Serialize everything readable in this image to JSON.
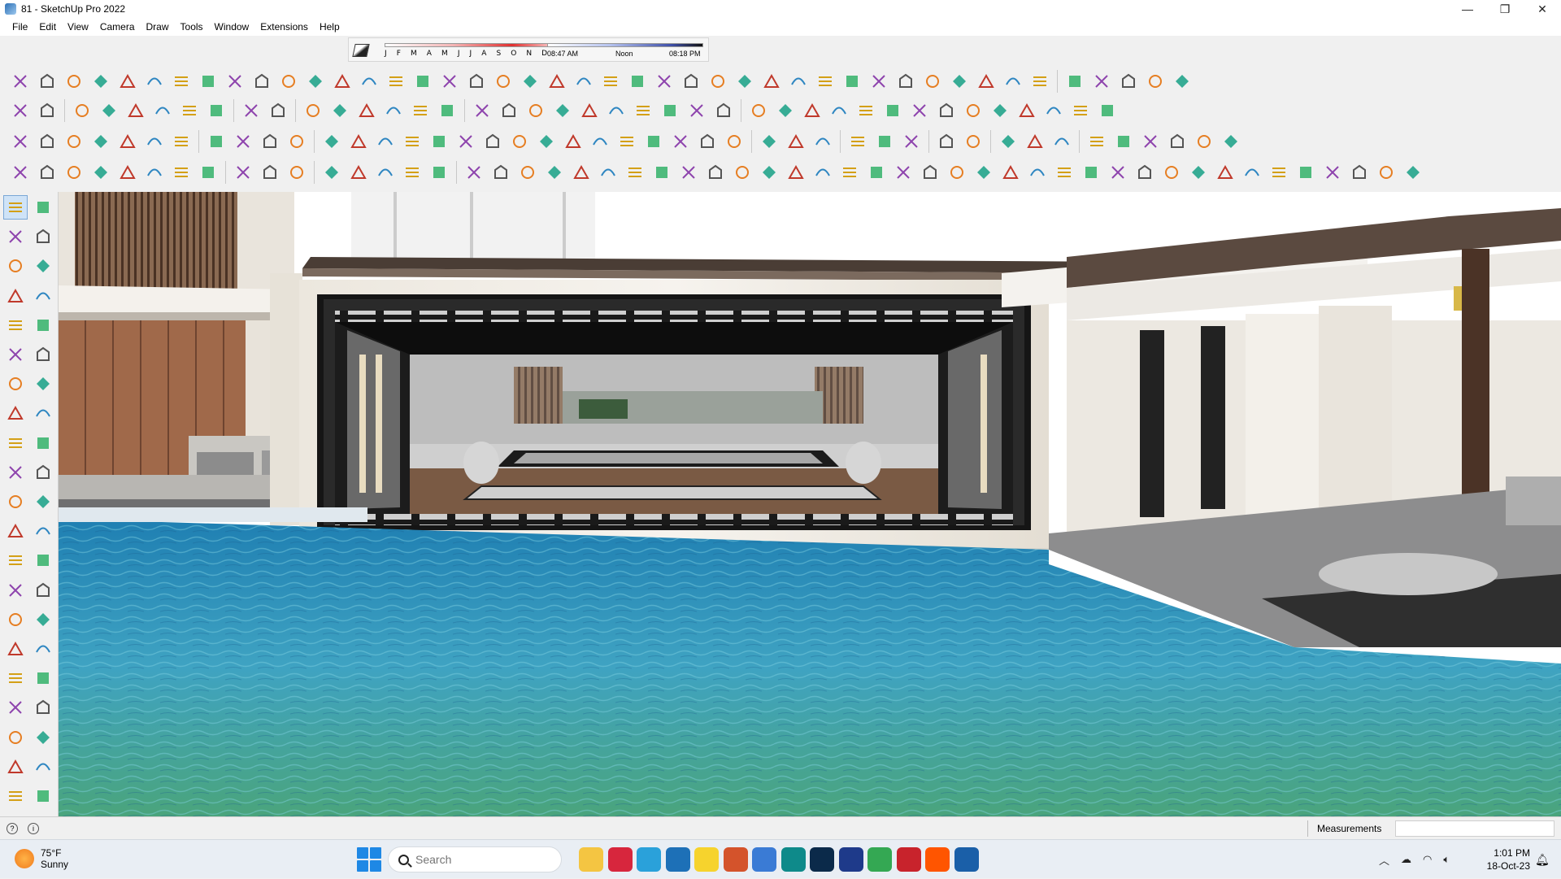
{
  "window": {
    "title": "81 - SketchUp Pro 2022",
    "controls": {
      "minimize": "—",
      "maximize": "❐",
      "close": "✕"
    }
  },
  "menubar": [
    "File",
    "Edit",
    "View",
    "Camera",
    "Draw",
    "Tools",
    "Window",
    "Extensions",
    "Help"
  ],
  "shadow_settings": {
    "months": "J F M A M J J A S O N D",
    "time_start": "08:47 AM",
    "time_mid": "Noon",
    "time_end": "08:18 PM"
  },
  "status_bar": {
    "measurements_label": "Measurements",
    "measurements_value": ""
  },
  "taskbar": {
    "weather": {
      "temp": "75°F",
      "condition": "Sunny"
    },
    "search_placeholder": "Search",
    "apps": [
      "file-explorer",
      "opera",
      "telegram",
      "sketchup-app",
      "sticky-notes",
      "grammarly",
      "visual-studio",
      "sketchup-3",
      "photoshop",
      "affinity",
      "chrome",
      "pinterest",
      "soundcloud",
      "sketchup-active"
    ],
    "clock": {
      "time": "1:01 PM",
      "date": "18-Oct-23"
    }
  },
  "colors": {
    "accent": "#1e88e5",
    "water": "#2b8fb8",
    "wood": "#7a5a44"
  }
}
